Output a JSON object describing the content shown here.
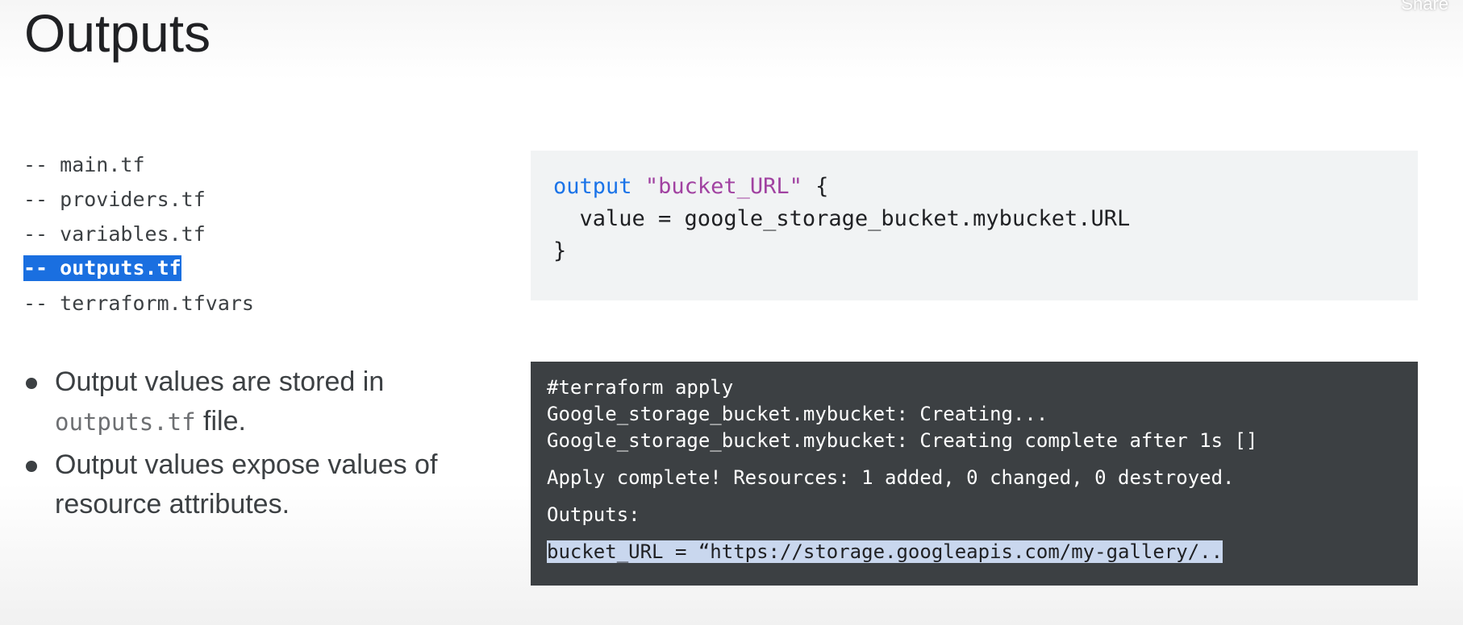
{
  "slide": {
    "title": "Outputs",
    "share_label": "Share"
  },
  "files": [
    "-- main.tf",
    "-- providers.tf",
    "-- variables.tf",
    "-- outputs.tf",
    "-- terraform.tfvars"
  ],
  "selected_file": "-- outputs.tf",
  "bullets": [
    {
      "before": "Output values are stored in",
      "code": "outputs.tf",
      "after": " file."
    },
    {
      "text": "Output values expose values of resource attributes."
    }
  ],
  "code": {
    "keyword": "output",
    "name": "\"bucket_URL\"",
    "open": " {",
    "value_line": "  value = google_storage_bucket.mybucket.URL",
    "close": "}"
  },
  "terminal": {
    "lines": [
      "#terraform apply",
      "Google_storage_bucket.mybucket: Creating...",
      "Google_storage_bucket.mybucket: Creating complete after 1s []",
      "Apply complete! Resources: 1 added, 0 changed, 0 destroyed.",
      "Outputs:",
      "bucket_URL = “https://storage.googleapis.com/my-gallery/.."
    ]
  },
  "colors": {
    "keyword": "#1a73e8",
    "string": "#a142a1",
    "selection": "#1a6fe0",
    "terminal_bg": "#3c4043"
  }
}
